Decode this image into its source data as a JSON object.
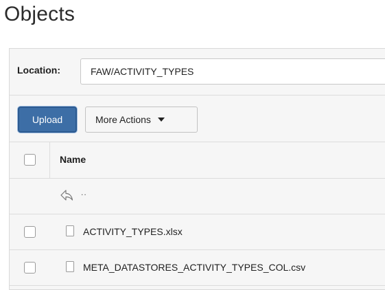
{
  "page": {
    "title": "Objects"
  },
  "location": {
    "label": "Location:",
    "value": "FAW/ACTIVITY_TYPES"
  },
  "toolbar": {
    "upload_label": "Upload",
    "more_actions_label": "More Actions"
  },
  "table": {
    "columns": [
      {
        "label": "Name"
      }
    ],
    "parent_row": {
      "label": ".."
    },
    "rows": [
      {
        "name": "ACTIVITY_TYPES.xlsx",
        "icon": "file-icon"
      },
      {
        "name": "META_DATASTORES_ACTIVITY_TYPES_COL.csv",
        "icon": "file-icon"
      }
    ]
  },
  "colors": {
    "primary_button": "#3d6ea6",
    "panel_background": "#f6f6f6",
    "border": "#dcdcdc"
  }
}
